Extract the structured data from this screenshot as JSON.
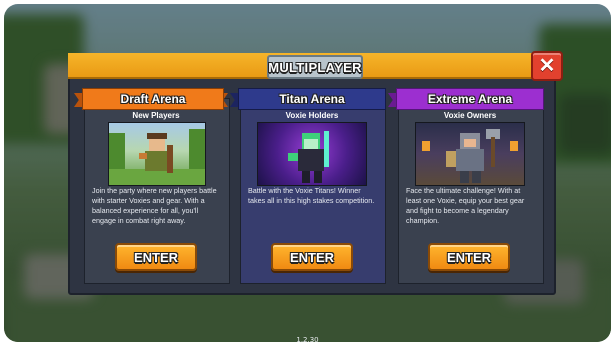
{
  "window": {
    "title": "MULTIPLAYER",
    "close_label": "✕"
  },
  "arenas": [
    {
      "name": "Draft Arena",
      "subtitle": "New Players",
      "description": "Join the party where new players battle with starter Voxies and gear. With a balanced experience for all, you'll engage in combat right away.",
      "button": "ENTER",
      "ribbon_color": "#f07a1a"
    },
    {
      "name": "Titan Arena",
      "subtitle": "Voxie Holders",
      "description": "Battle with the Voxie Titans! Winner takes all in this high stakes competition.",
      "button": "ENTER",
      "ribbon_color": "#2e3a8c"
    },
    {
      "name": "Extreme Arena",
      "subtitle": "Voxie Owners",
      "description": "Face the ultimate challenge! With at least one Voxie, equip your best gear and fight to become a legendary champion.",
      "button": "ENTER",
      "ribbon_color": "#9c2fd0"
    }
  ],
  "version": "1.2.30",
  "colors": {
    "accent": "#f0a21c",
    "close": "#e2412e",
    "button": "#f59a1e"
  }
}
